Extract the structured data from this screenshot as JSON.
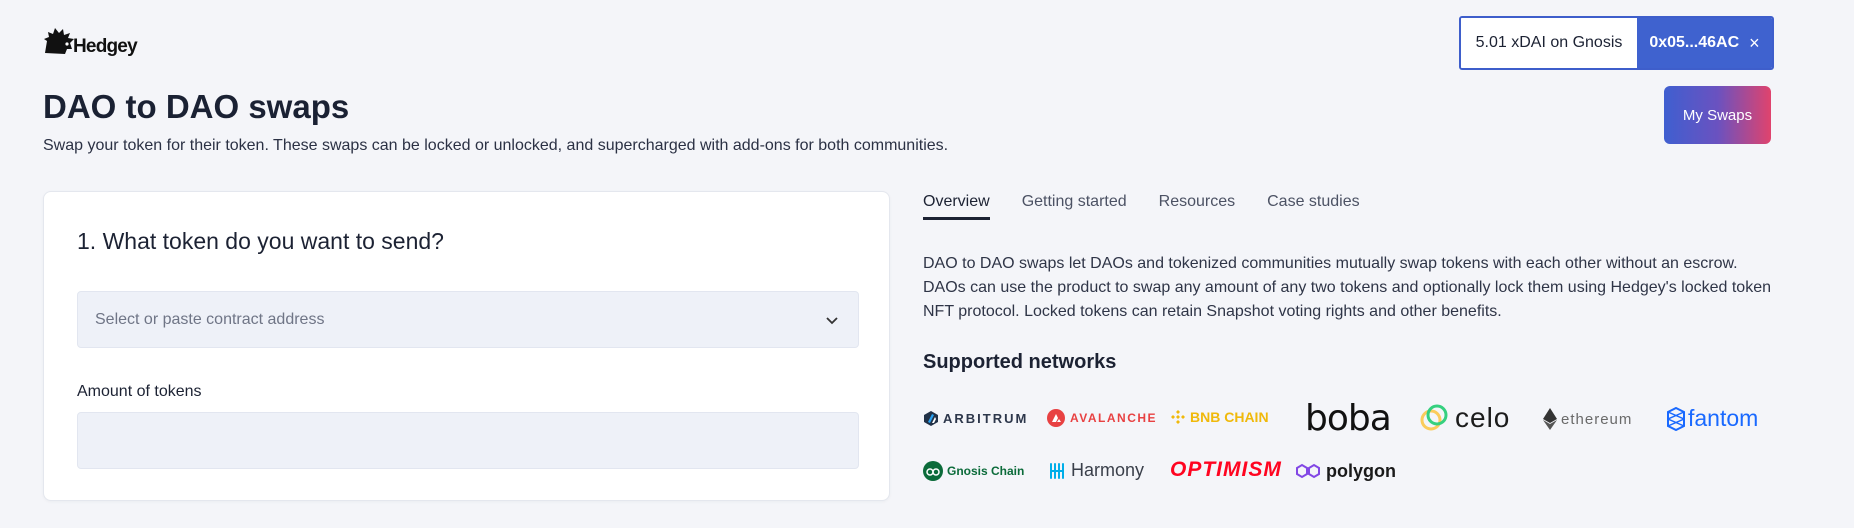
{
  "brand": {
    "name": "Hedgey"
  },
  "wallet": {
    "balance": "5.01 xDAI on Gnosis",
    "address": "0x05...46AC",
    "disconnect_glyph": "×"
  },
  "header": {
    "title": "DAO to DAO swaps",
    "subtitle": "Swap your token for their token. These swaps can be locked or unlocked, and supercharged with add-ons for both communities.",
    "my_swaps_label": "My Swaps"
  },
  "form": {
    "question": "1. What token do you want to send?",
    "token_select_placeholder": "Select or paste contract address",
    "amount_label": "Amount of tokens",
    "amount_value": ""
  },
  "tabs": [
    {
      "label": "Overview",
      "active": true
    },
    {
      "label": "Getting started",
      "active": false
    },
    {
      "label": "Resources",
      "active": false
    },
    {
      "label": "Case studies",
      "active": false
    }
  ],
  "overview": {
    "description": "DAO to DAO swaps let DAOs and tokenized communities mutually swap tokens with each other without an escrow. DAOs can use the product to swap any amount of any two tokens and optionally lock them using Hedgey's locked token NFT protocol. Locked tokens can retain Snapshot voting rights and other benefits.",
    "networks_title": "Supported networks"
  },
  "networks": [
    {
      "name": "ARBITRUM",
      "icon": "arbitrum-icon",
      "color": "#2d374b"
    },
    {
      "name": "AVALANCHE",
      "icon": "avalanche-icon",
      "color": "#e84142"
    },
    {
      "name": "BNB CHAIN",
      "icon": "bnb-icon",
      "color": "#f0b90b"
    },
    {
      "name": "boba",
      "icon": "boba-icon",
      "color": "#111111"
    },
    {
      "name": "celo",
      "icon": "celo-icon",
      "color": "#fbcc5c"
    },
    {
      "name": "ethereum",
      "icon": "ethereum-icon",
      "color": "#6a6a6a"
    },
    {
      "name": "fantom",
      "icon": "fantom-icon",
      "color": "#1969ff"
    },
    {
      "name": "Gnosis Chain",
      "icon": "gnosis-icon",
      "color": "#0b6b3a"
    },
    {
      "name": "Harmony",
      "icon": "harmony-icon",
      "color": "#00aee9"
    },
    {
      "name": "OPTIMISM",
      "icon": "optimism-icon",
      "color": "#ff0420"
    },
    {
      "name": "polygon",
      "icon": "polygon-icon",
      "color": "#8247e5"
    }
  ],
  "colors": {
    "accent": "#3f62cf",
    "background": "#f4f5f9",
    "gradient_end": "#e0436d"
  }
}
